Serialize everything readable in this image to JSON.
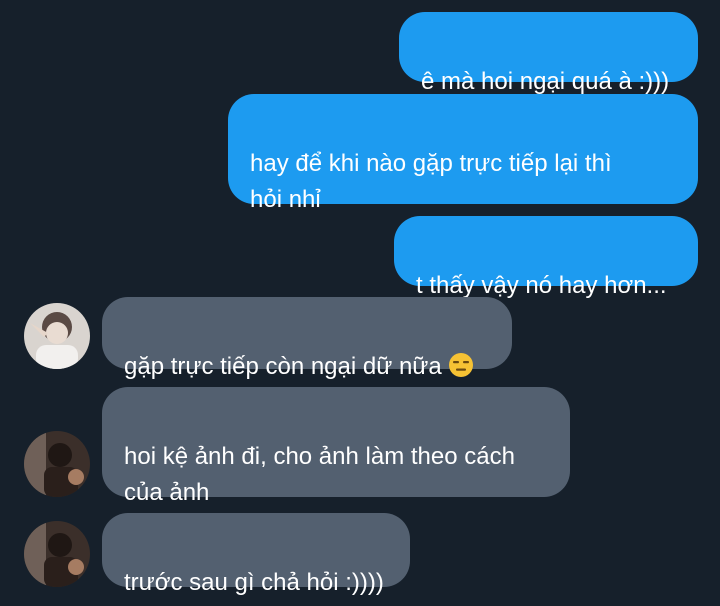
{
  "messages": [
    {
      "side": "out",
      "text": "ê mà hoi ngại quá à :)))"
    },
    {
      "side": "out",
      "text": "hay để khi nào gặp trực tiếp lại thì\nhỏi nhỉ"
    },
    {
      "side": "out",
      "text": "t thấy vậy nó hay hơn..."
    },
    {
      "side": "in",
      "text": "gặp trực tiếp còn ngại dữ nữa ",
      "emoji": "expressionless-face-emoji"
    },
    {
      "side": "in",
      "text": "hoi kệ ảnh đi, cho ảnh làm theo cách\ncủa ảnh"
    },
    {
      "side": "in",
      "text": "trước sau gì chả hỏi :))))"
    }
  ],
  "colors": {
    "background": "#16202b",
    "outgoing_bubble": "#1d9bf0",
    "incoming_bubble": "#536070"
  }
}
